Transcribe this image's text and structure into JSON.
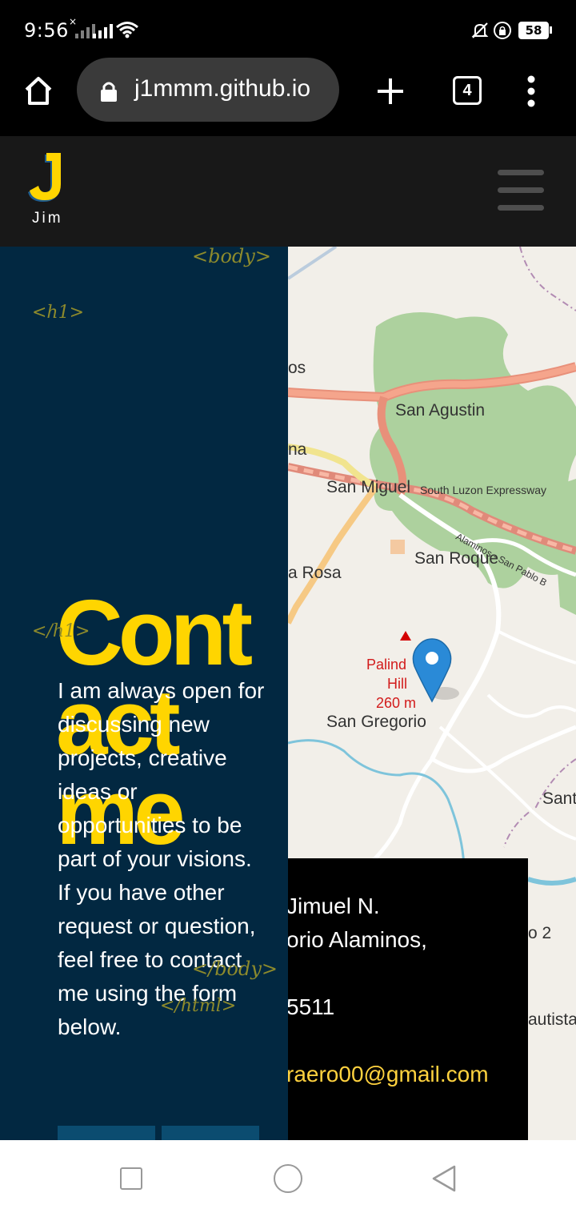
{
  "status_bar": {
    "time": "9:56",
    "battery": "58",
    "icons": [
      "signal-x-icon",
      "signal-icon",
      "wifi-icon",
      "mute-icon",
      "lock-icon",
      "battery-icon"
    ]
  },
  "browser": {
    "url": "j1mmm.github.io",
    "tab_count": "4",
    "icons": [
      "home-icon",
      "lock-icon",
      "plus-icon",
      "tabs-icon",
      "more-icon"
    ]
  },
  "nav": {
    "logo_letter": "J",
    "logo_name": "Jim",
    "icons": [
      "hamburger-menu-icon"
    ]
  },
  "content": {
    "tag_body_open": "<body>",
    "tag_h1_open": "<h1>",
    "heading_lines": [
      "Cont",
      "act",
      "me"
    ],
    "tag_h1_close": "</h1>",
    "paragraph": "I am always open for discussing new projects, creative ideas or opportunities to be part of your visions. If you have other request or question, feel free to contact me using the form below.",
    "tag_body_close": "</body>",
    "tag_html_close": "</html>"
  },
  "info_box": {
    "name": "Jimuel N.",
    "address": "orio Alaminos,",
    "phone": "5511",
    "email": "raero00@gmail.com"
  },
  "map": {
    "labels": {
      "san_agustin": "San Agustin",
      "san_miguel": "San Miguel",
      "expressway": "South Luzon Expressway",
      "alaminos_road": "Alaminos - San Pablo B",
      "san_roque": "San Roque",
      "rosa": "a Rosa",
      "os": "os",
      "na": "na",
      "hill_1": "Palind",
      "hill_2": "Hill",
      "hill_3": "260 m",
      "san_gregorio": "San Gregorio",
      "sant": "Sant",
      "o2": "o 2",
      "bautista": "autista"
    },
    "colors": {
      "road_major": "#f0917a",
      "road_secondary": "#f6c984",
      "forest": "#a4d99a",
      "water": "#7ec4db",
      "background": "#f2efe9",
      "marker": "#2a8ad7"
    }
  },
  "system_nav": {
    "icons": [
      "recent-apps-icon",
      "home-circle-icon",
      "back-icon"
    ]
  },
  "colors": {
    "panel": "#022841",
    "accent_yellow": "#ffd500",
    "tag_olive": "#8d8a2c",
    "navbar": "#181818"
  }
}
